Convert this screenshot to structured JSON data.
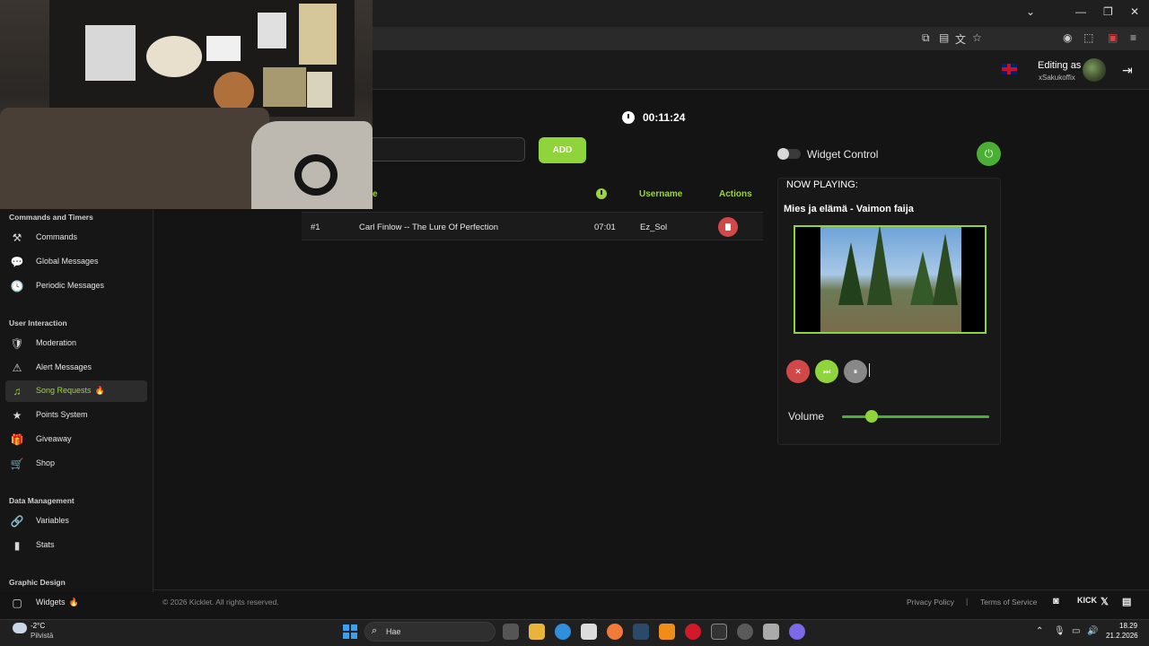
{
  "browser": {
    "window_controls": [
      "⌄",
      "—",
      "❐",
      "✕"
    ]
  },
  "header": {
    "editing_label": "Editing as",
    "username": "xSakukoffix",
    "logout_icon": "logout-icon"
  },
  "sidebar": {
    "sections": [
      {
        "title": "Commands and Timers",
        "items": [
          {
            "label": "Commands",
            "icon": "⚒"
          },
          {
            "label": "Global Messages",
            "icon": "💬"
          },
          {
            "label": "Periodic Messages",
            "icon": "🕓"
          }
        ]
      },
      {
        "title": "User Interaction",
        "items": [
          {
            "label": "Moderation",
            "icon": "🛡"
          },
          {
            "label": "Alert Messages",
            "icon": "⚠"
          },
          {
            "label": "Song Requests",
            "icon": "♫",
            "badge": "🔥",
            "active": true
          },
          {
            "label": "Points System",
            "icon": "★"
          },
          {
            "label": "Giveaway",
            "icon": "🎁"
          },
          {
            "label": "Shop",
            "icon": "🛒"
          }
        ]
      },
      {
        "title": "Data Management",
        "items": [
          {
            "label": "Variables",
            "icon": "🔗"
          },
          {
            "label": "Stats",
            "icon": "▮"
          }
        ]
      },
      {
        "title": "Graphic Design",
        "items": [
          {
            "label": "Widgets",
            "icon": "▢",
            "badge": "🔥"
          }
        ]
      }
    ]
  },
  "main": {
    "timer": "00:11:24",
    "add_label": "ADD",
    "song_input_value": "",
    "table": {
      "headers": {
        "title": "e",
        "username": "Username",
        "actions": "Actions"
      },
      "rows": [
        {
          "index": "#1",
          "title": "Carl Finlow -- The Lure Of Perfection",
          "duration": "07:01",
          "username": "Ez_Sol"
        }
      ]
    }
  },
  "widget": {
    "control_label": "Widget Control",
    "control_enabled": false,
    "now_playing_label": "NOW PLAYING:",
    "now_playing_title": "Mies ja elämä - Vaimon faija",
    "volume_label": "Volume",
    "volume_value": 0.2,
    "accent_color": "#8fd43b"
  },
  "footer": {
    "copyright": "© 2026 Kicklet. All rights reserved.",
    "privacy": "Privacy Policy",
    "separator": "|",
    "terms": "Terms of Service",
    "kick": "KICK",
    "x": "𝕏"
  },
  "taskbar": {
    "temperature": "-2°C",
    "condition": "Pilvistä",
    "search_placeholder": "Hae",
    "time": "18.29",
    "date": "21.2.2026"
  }
}
